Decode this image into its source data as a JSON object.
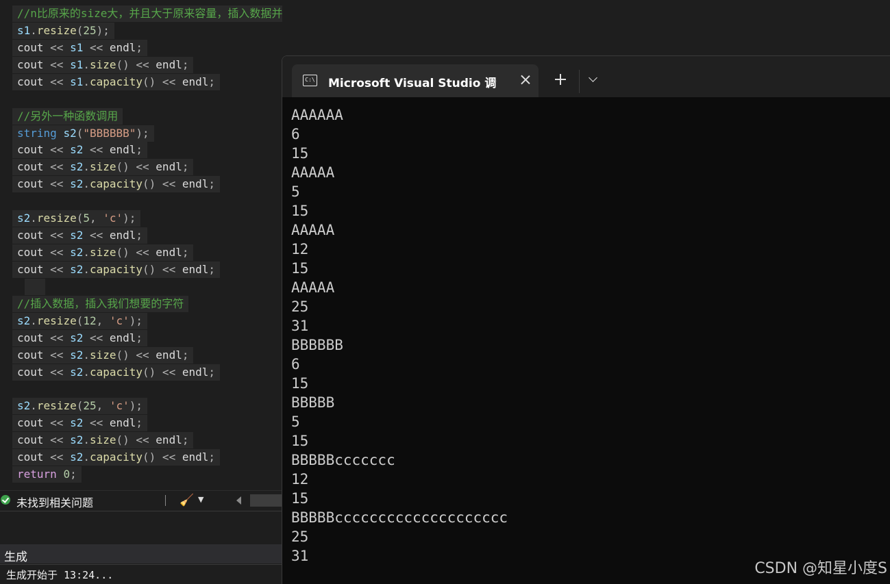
{
  "editor": {
    "lines": [
      {
        "tokens": [
          {
            "t": "//n比原来的size大，并且大于原来容量，插入数据并且扩容",
            "c": "cm"
          }
        ]
      },
      {
        "tokens": [
          {
            "t": "s1",
            "c": "var"
          },
          {
            "t": ".",
            "c": "p"
          },
          {
            "t": "resize",
            "c": "fn"
          },
          {
            "t": "(",
            "c": "p"
          },
          {
            "t": "25",
            "c": "num"
          },
          {
            "t": ");",
            "c": "p"
          }
        ]
      },
      {
        "tokens": [
          {
            "t": "cout",
            "c": "id"
          },
          {
            "t": " << ",
            "c": "p"
          },
          {
            "t": "s1",
            "c": "var"
          },
          {
            "t": " << ",
            "c": "p"
          },
          {
            "t": "endl",
            "c": "id"
          },
          {
            "t": ";",
            "c": "p"
          }
        ]
      },
      {
        "tokens": [
          {
            "t": "cout",
            "c": "id"
          },
          {
            "t": " << ",
            "c": "p"
          },
          {
            "t": "s1",
            "c": "var"
          },
          {
            "t": ".",
            "c": "p"
          },
          {
            "t": "size",
            "c": "fn"
          },
          {
            "t": "() << ",
            "c": "p"
          },
          {
            "t": "endl",
            "c": "id"
          },
          {
            "t": ";",
            "c": "p"
          }
        ]
      },
      {
        "tokens": [
          {
            "t": "cout",
            "c": "id"
          },
          {
            "t": " << ",
            "c": "p"
          },
          {
            "t": "s1",
            "c": "var"
          },
          {
            "t": ".",
            "c": "p"
          },
          {
            "t": "capacity",
            "c": "fn"
          },
          {
            "t": "() << ",
            "c": "p"
          },
          {
            "t": "endl",
            "c": "id"
          },
          {
            "t": ";",
            "c": "p"
          }
        ]
      },
      {
        "tokens": []
      },
      {
        "tokens": [
          {
            "t": "//另外一种函数调用",
            "c": "cm"
          }
        ]
      },
      {
        "tokens": [
          {
            "t": "string",
            "c": "kw"
          },
          {
            "t": " ",
            "c": "p"
          },
          {
            "t": "s2",
            "c": "var"
          },
          {
            "t": "(",
            "c": "p"
          },
          {
            "t": "\"BBBBBB\"",
            "c": "str"
          },
          {
            "t": ");",
            "c": "p"
          }
        ]
      },
      {
        "tokens": [
          {
            "t": "cout",
            "c": "id"
          },
          {
            "t": " << ",
            "c": "p"
          },
          {
            "t": "s2",
            "c": "var"
          },
          {
            "t": " << ",
            "c": "p"
          },
          {
            "t": "endl",
            "c": "id"
          },
          {
            "t": ";",
            "c": "p"
          }
        ]
      },
      {
        "tokens": [
          {
            "t": "cout",
            "c": "id"
          },
          {
            "t": " << ",
            "c": "p"
          },
          {
            "t": "s2",
            "c": "var"
          },
          {
            "t": ".",
            "c": "p"
          },
          {
            "t": "size",
            "c": "fn"
          },
          {
            "t": "() << ",
            "c": "p"
          },
          {
            "t": "endl",
            "c": "id"
          },
          {
            "t": ";",
            "c": "p"
          }
        ]
      },
      {
        "tokens": [
          {
            "t": "cout",
            "c": "id"
          },
          {
            "t": " << ",
            "c": "p"
          },
          {
            "t": "s2",
            "c": "var"
          },
          {
            "t": ".",
            "c": "p"
          },
          {
            "t": "capacity",
            "c": "fn"
          },
          {
            "t": "() << ",
            "c": "p"
          },
          {
            "t": "endl",
            "c": "id"
          },
          {
            "t": ";",
            "c": "p"
          }
        ]
      },
      {
        "tokens": []
      },
      {
        "tokens": [
          {
            "t": "s2",
            "c": "var"
          },
          {
            "t": ".",
            "c": "p"
          },
          {
            "t": "resize",
            "c": "fn"
          },
          {
            "t": "(",
            "c": "p"
          },
          {
            "t": "5",
            "c": "num"
          },
          {
            "t": ", ",
            "c": "p"
          },
          {
            "t": "'c'",
            "c": "str"
          },
          {
            "t": ");",
            "c": "p"
          }
        ]
      },
      {
        "tokens": [
          {
            "t": "cout",
            "c": "id"
          },
          {
            "t": " << ",
            "c": "p"
          },
          {
            "t": "s2",
            "c": "var"
          },
          {
            "t": " << ",
            "c": "p"
          },
          {
            "t": "endl",
            "c": "id"
          },
          {
            "t": ";",
            "c": "p"
          }
        ]
      },
      {
        "tokens": [
          {
            "t": "cout",
            "c": "id"
          },
          {
            "t": " << ",
            "c": "p"
          },
          {
            "t": "s2",
            "c": "var"
          },
          {
            "t": ".",
            "c": "p"
          },
          {
            "t": "size",
            "c": "fn"
          },
          {
            "t": "() << ",
            "c": "p"
          },
          {
            "t": "endl",
            "c": "id"
          },
          {
            "t": ";",
            "c": "p"
          }
        ]
      },
      {
        "tokens": [
          {
            "t": "cout",
            "c": "id"
          },
          {
            "t": " << ",
            "c": "p"
          },
          {
            "t": "s2",
            "c": "var"
          },
          {
            "t": ".",
            "c": "p"
          },
          {
            "t": "capacity",
            "c": "fn"
          },
          {
            "t": "() << ",
            "c": "p"
          },
          {
            "t": "endl",
            "c": "id"
          },
          {
            "t": ";",
            "c": "p"
          }
        ]
      },
      {
        "tokens": []
      },
      {
        "tokens": [
          {
            "t": "//插入数据，插入我们想要的字符",
            "c": "cm"
          }
        ]
      },
      {
        "tokens": [
          {
            "t": "s2",
            "c": "var"
          },
          {
            "t": ".",
            "c": "p"
          },
          {
            "t": "resize",
            "c": "fn"
          },
          {
            "t": "(",
            "c": "p"
          },
          {
            "t": "12",
            "c": "num"
          },
          {
            "t": ", ",
            "c": "p"
          },
          {
            "t": "'c'",
            "c": "str"
          },
          {
            "t": ");",
            "c": "p"
          }
        ]
      },
      {
        "tokens": [
          {
            "t": "cout",
            "c": "id"
          },
          {
            "t": " << ",
            "c": "p"
          },
          {
            "t": "s2",
            "c": "var"
          },
          {
            "t": " << ",
            "c": "p"
          },
          {
            "t": "endl",
            "c": "id"
          },
          {
            "t": ";",
            "c": "p"
          }
        ]
      },
      {
        "tokens": [
          {
            "t": "cout",
            "c": "id"
          },
          {
            "t": " << ",
            "c": "p"
          },
          {
            "t": "s2",
            "c": "var"
          },
          {
            "t": ".",
            "c": "p"
          },
          {
            "t": "size",
            "c": "fn"
          },
          {
            "t": "() << ",
            "c": "p"
          },
          {
            "t": "endl",
            "c": "id"
          },
          {
            "t": ";",
            "c": "p"
          }
        ]
      },
      {
        "tokens": [
          {
            "t": "cout",
            "c": "id"
          },
          {
            "t": " << ",
            "c": "p"
          },
          {
            "t": "s2",
            "c": "var"
          },
          {
            "t": ".",
            "c": "p"
          },
          {
            "t": "capacity",
            "c": "fn"
          },
          {
            "t": "() << ",
            "c": "p"
          },
          {
            "t": "endl",
            "c": "id"
          },
          {
            "t": ";",
            "c": "p"
          }
        ]
      },
      {
        "tokens": []
      },
      {
        "tokens": [
          {
            "t": "s2",
            "c": "var"
          },
          {
            "t": ".",
            "c": "p"
          },
          {
            "t": "resize",
            "c": "fn"
          },
          {
            "t": "(",
            "c": "p"
          },
          {
            "t": "25",
            "c": "num"
          },
          {
            "t": ", ",
            "c": "p"
          },
          {
            "t": "'c'",
            "c": "str"
          },
          {
            "t": ");",
            "c": "p"
          }
        ]
      },
      {
        "tokens": [
          {
            "t": "cout",
            "c": "id"
          },
          {
            "t": " << ",
            "c": "p"
          },
          {
            "t": "s2",
            "c": "var"
          },
          {
            "t": " << ",
            "c": "p"
          },
          {
            "t": "endl",
            "c": "id"
          },
          {
            "t": ";",
            "c": "p"
          }
        ]
      },
      {
        "tokens": [
          {
            "t": "cout",
            "c": "id"
          },
          {
            "t": " << ",
            "c": "p"
          },
          {
            "t": "s2",
            "c": "var"
          },
          {
            "t": ".",
            "c": "p"
          },
          {
            "t": "size",
            "c": "fn"
          },
          {
            "t": "() << ",
            "c": "p"
          },
          {
            "t": "endl",
            "c": "id"
          },
          {
            "t": ";",
            "c": "p"
          }
        ]
      },
      {
        "tokens": [
          {
            "t": "cout",
            "c": "id"
          },
          {
            "t": " << ",
            "c": "p"
          },
          {
            "t": "s2",
            "c": "var"
          },
          {
            "t": ".",
            "c": "p"
          },
          {
            "t": "capacity",
            "c": "fn"
          },
          {
            "t": "() << ",
            "c": "p"
          },
          {
            "t": "endl",
            "c": "id"
          },
          {
            "t": ";",
            "c": "p"
          }
        ]
      },
      {
        "tokens": [
          {
            "t": "return",
            "c": "ctl"
          },
          {
            "t": " ",
            "c": "p"
          },
          {
            "t": "0",
            "c": "num"
          },
          {
            "t": ";",
            "c": "p"
          }
        ]
      }
    ]
  },
  "statusbar": {
    "issues_text": "未找到相关问题",
    "ok_icon": "check-circle-icon",
    "cleanup_icon": "broom-icon",
    "dropdown_glyph": "▼",
    "broom_glyph": "🧹"
  },
  "output_panel": {
    "title": "生成",
    "log": "生成开始于 13:24..."
  },
  "terminal": {
    "tab_title": "Microsoft Visual Studio 调试控制台",
    "tab_icon": "console-icon",
    "tab_icon_glyph": "C:\\",
    "lines": [
      "AAAAAA",
      "6",
      "15",
      "AAAAA",
      "5",
      "15",
      "AAAAA",
      "12",
      "15",
      "AAAAA",
      "25",
      "31",
      "BBBBBB",
      "6",
      "15",
      "BBBBB",
      "5",
      "15",
      "BBBBBccccccc",
      "12",
      "15",
      "BBBBBcccccccccccccccccccc",
      "25",
      "31"
    ]
  },
  "watermark": "CSDN @知星小度S",
  "colors": {
    "editor_bg": "#1e1e1e",
    "line_highlight": "#2a2a2a",
    "comment": "#57a64a",
    "keyword": "#569cd6",
    "string": "#d69d85",
    "function": "#dcdcaa",
    "terminal_bg": "#0c0c0c"
  }
}
